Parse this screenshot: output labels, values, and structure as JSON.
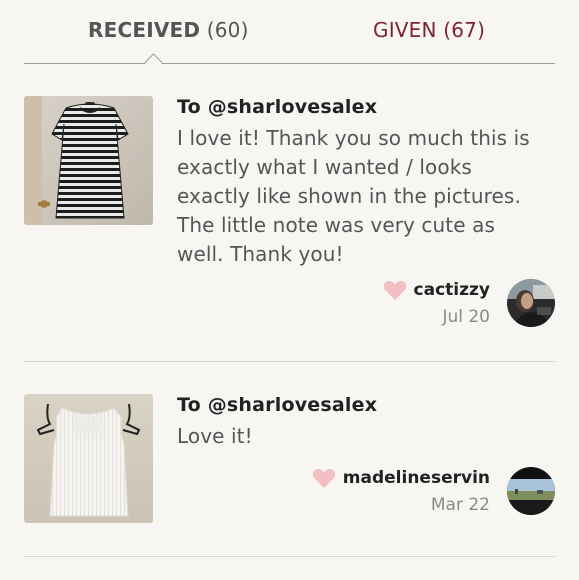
{
  "tabs": {
    "received": {
      "label": "RECEIVED",
      "count": "(60)"
    },
    "given": {
      "label": "GIVEN",
      "count": "(67)"
    }
  },
  "reviews": [
    {
      "to": "To @sharlovesalex",
      "text": "I love it! Thank you so much this is exactly what I wanted / looks exactly like shown in the pictures. The little note was very cute as well. Thank you!",
      "reviewer": "cactizzy",
      "date": "Jul 20",
      "item": "striped t-shirt dress"
    },
    {
      "to": "To @sharlovesalex",
      "text": "Love it!",
      "reviewer": "madelineservin",
      "date": "Mar 22",
      "item": "white sleeveless top"
    }
  ],
  "colors": {
    "background": "#f7f6f3",
    "given_accent": "#7d2531",
    "heart": "#f4bfc3",
    "text_dark": "#222222",
    "text_body": "#555555",
    "text_muted": "#8a8a8a"
  }
}
